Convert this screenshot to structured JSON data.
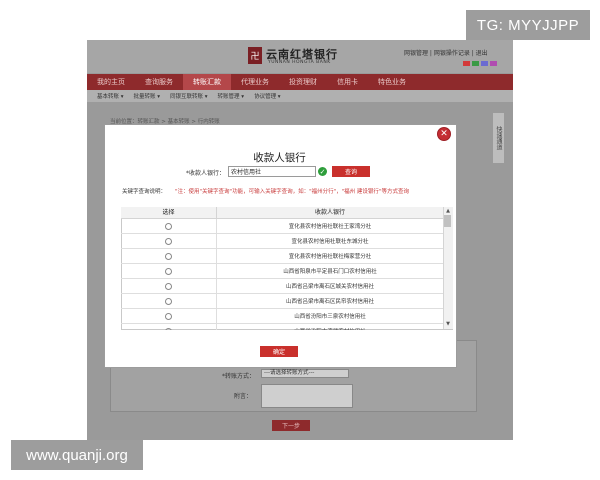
{
  "watermarks": {
    "tg": "TG: MYYJJPP",
    "site": "www.quanji.org"
  },
  "bank": {
    "logo_glyph": "卍",
    "name_cn": "云南红塔银行",
    "name_en": "YUNNAN HONGTA BANK"
  },
  "top_links": "网银管理 | 网银操作记录 | 退出",
  "theme_colors": [
    "#d33a3a",
    "#3a9a45",
    "#6b6bd1",
    "#b04cb0"
  ],
  "nav": {
    "items": [
      "我的主页",
      "查询服务",
      "转账汇款",
      "代理业务",
      "投资理财",
      "信用卡",
      "特色业务"
    ],
    "active_index": 2
  },
  "subnav": [
    "基本转账 ▾",
    "批量转账 ▾",
    "同银互联转账 ▾",
    "转账管理 ▾",
    "协议管理 ▾"
  ],
  "breadcrumb": "当前位置：转账汇款 > 基本转账 > 行内转账",
  "side_tab": "快速通道",
  "background_form": {
    "method_label": "*转账方式：",
    "method_placeholder": "---请选择转账方式---",
    "note_label": "附言：",
    "next_button": "下一步"
  },
  "modal": {
    "title": "收款人银行",
    "bank_label": "*收款人银行：",
    "bank_value": "农村信用社",
    "query_button": "查询",
    "hint_label": "关键字查询说明：",
    "hint_text": "\"注：使用\"关键字查询\"功能，可输入关键字查询，如：\"福州分行\"，\"福州 建设银行\"等方式查询",
    "table": {
      "headers": [
        "选择",
        "收款人银行"
      ],
      "rows": [
        "宣化县农村信用社联社王家湾分社",
        "宣化县农村信用社联社东城分社",
        "宣化县农村信用社联社梅家营分社",
        "山西省阳泉市平定县石门口农村信用社",
        "山西省吕梁市离石区城关农村信用社",
        "山西省吕梁市离石区民帘农村信用社",
        "山西省汾阳市三泉农村信用社",
        "山西省汾阳市演武农村信用社"
      ]
    },
    "confirm_button": "确定"
  }
}
